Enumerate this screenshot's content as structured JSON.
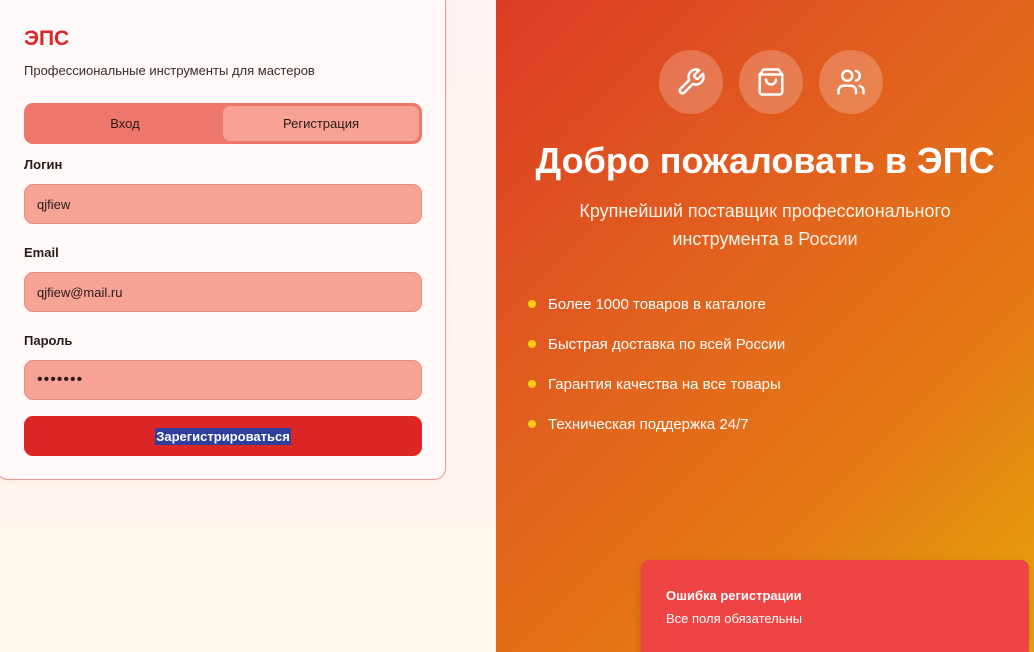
{
  "brand": "ЭПС",
  "tagline": "Профессиональные инструменты для мастеров",
  "tabs": [
    {
      "label": "Вход",
      "active": false
    },
    {
      "label": "Регистрация",
      "active": true
    }
  ],
  "form": {
    "login_label": "Логин",
    "login_value": "qjfiew",
    "email_label": "Email",
    "email_value": "qjfiew@mail.ru",
    "password_label": "Пароль",
    "password_value": "•••••••",
    "submit_label": "Зарегистрироваться"
  },
  "hero": {
    "icons": [
      "wrench-icon",
      "shopping-bag-icon",
      "users-icon"
    ],
    "title": "Добро пожаловать в ЭПС",
    "subtitle": "Крупнейший поставщик профессионального инструмента в России",
    "features": [
      "Более 1000 товаров в каталоге",
      "Быстрая доставка по всей России",
      "Гарантия качества на все товары",
      "Техническая поддержка 24/7"
    ]
  },
  "toast": {
    "title": "Ошибка регистрации",
    "message": "Все поля обязательны"
  },
  "colors": {
    "accent": "#dc2626",
    "gradient_start": "#dc3b25",
    "gradient_end": "#e5a60b",
    "bullet": "#facc15",
    "toast_bg": "#ef4444"
  }
}
